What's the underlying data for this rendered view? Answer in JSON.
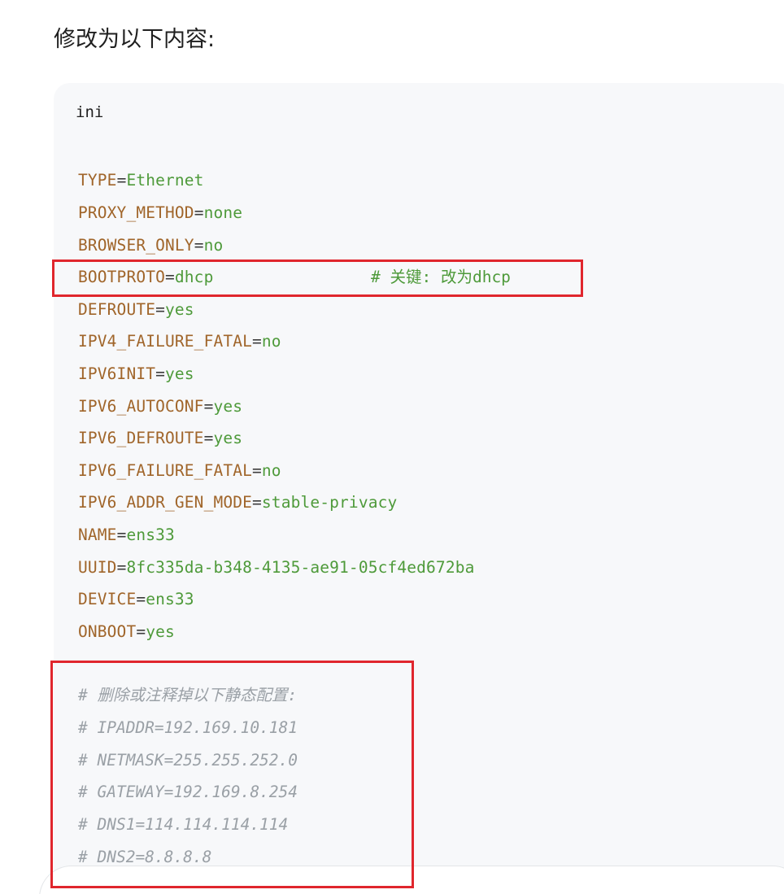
{
  "heading": "修改为以下内容:",
  "code": {
    "language": "ini",
    "lines": [
      {
        "key": "TYPE",
        "value": "Ethernet"
      },
      {
        "key": "PROXY_METHOD",
        "value": "none"
      },
      {
        "key": "BROWSER_ONLY",
        "value": "no"
      },
      {
        "key": "BOOTPROTO",
        "value": "dhcp",
        "comment": "# 关键: 改为dhcp"
      },
      {
        "key": "DEFROUTE",
        "value": "yes"
      },
      {
        "key": "IPV4_FAILURE_FATAL",
        "value": "no"
      },
      {
        "key": "IPV6INIT",
        "value": "yes"
      },
      {
        "key": "IPV6_AUTOCONF",
        "value": "yes"
      },
      {
        "key": "IPV6_DEFROUTE",
        "value": "yes"
      },
      {
        "key": "IPV6_FAILURE_FATAL",
        "value": "no"
      },
      {
        "key": "IPV6_ADDR_GEN_MODE",
        "value": "stable-privacy"
      },
      {
        "key": "NAME",
        "value": "ens33"
      },
      {
        "key": "UUID",
        "value": "8fc335da-b348-4135-ae91-05cf4ed672ba"
      },
      {
        "key": "DEVICE",
        "value": "ens33"
      },
      {
        "key": "ONBOOT",
        "value": "yes"
      }
    ],
    "comments": [
      "# 删除或注释掉以下静态配置:",
      "# IPADDR=192.169.10.181",
      "# NETMASK=255.255.252.0",
      "# GATEWAY=192.169.8.254",
      "# DNS1=114.114.114.114",
      "# DNS2=8.8.8.8"
    ]
  },
  "colors": {
    "key": "#a0652a",
    "value": "#4e9a3a",
    "comment": "#9aa0a6",
    "highlight_border": "#e0262d",
    "code_background": "#f7f8fa"
  }
}
